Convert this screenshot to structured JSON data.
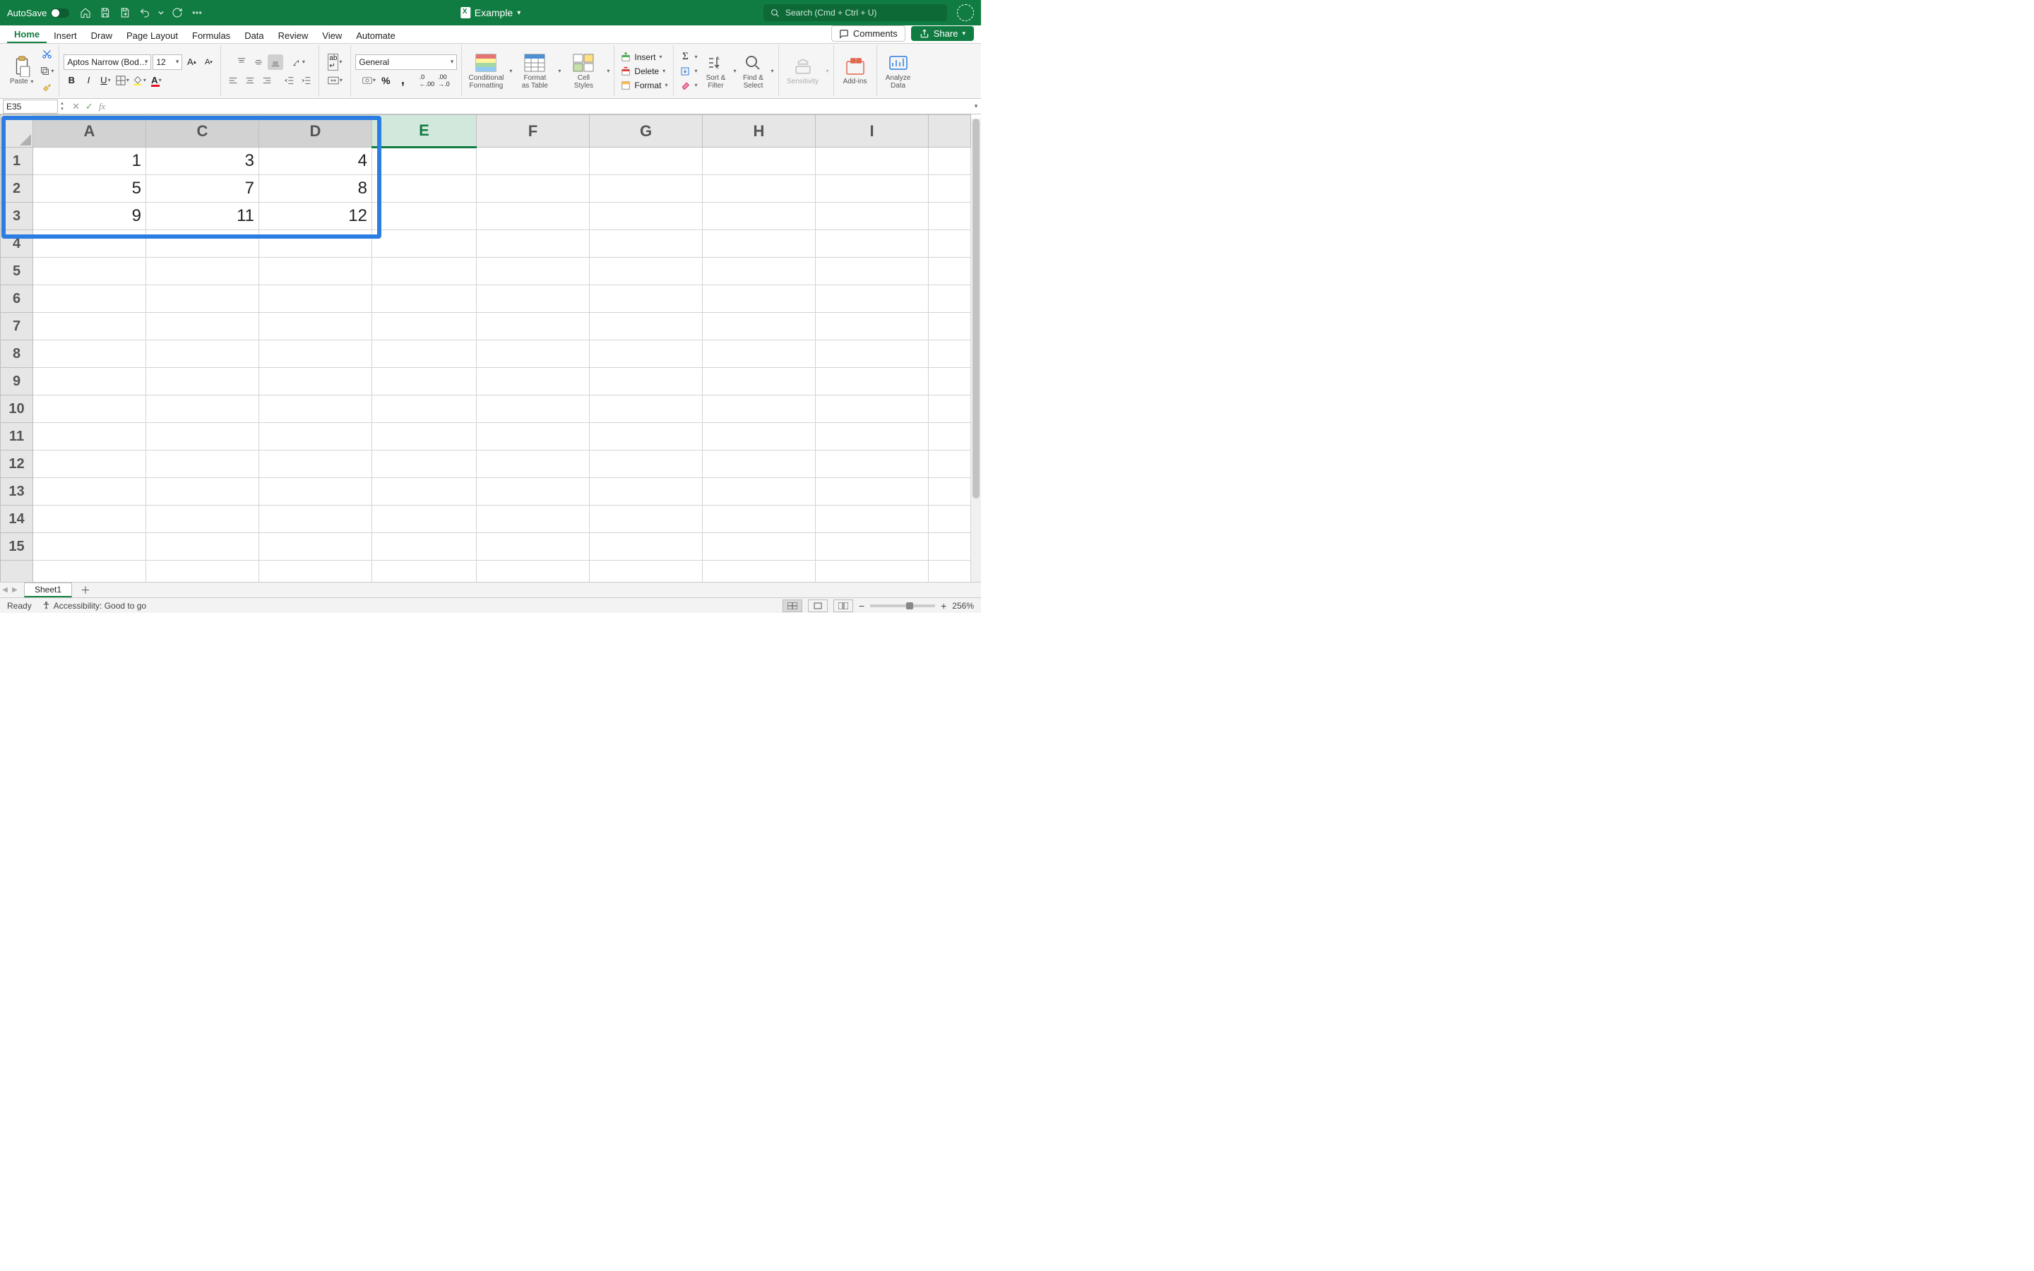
{
  "titlebar": {
    "autosave_label": "AutoSave",
    "doc_name": "Example",
    "search_placeholder": "Search (Cmd + Ctrl + U)"
  },
  "tabs": [
    "Home",
    "Insert",
    "Draw",
    "Page Layout",
    "Formulas",
    "Data",
    "Review",
    "View",
    "Automate"
  ],
  "active_tab": "Home",
  "ribbon_right": {
    "comments": "Comments",
    "share": "Share"
  },
  "ribbon": {
    "paste": "Paste",
    "font_name": "Aptos Narrow (Bod…",
    "font_size": "12",
    "number_format": "General",
    "conditional_formatting": "Conditional\nFormatting",
    "format_as_table": "Format\nas Table",
    "cell_styles": "Cell\nStyles",
    "insert": "Insert",
    "delete": "Delete",
    "format": "Format",
    "sort_filter": "Sort &\nFilter",
    "find_select": "Find &\nSelect",
    "sensitivity": "Sensitivity",
    "addins": "Add-ins",
    "analyze": "Analyze\nData"
  },
  "formula_bar": {
    "name_box": "E35",
    "formula": ""
  },
  "columns": [
    "A",
    "C",
    "D",
    "E",
    "F",
    "G",
    "H",
    "I",
    ""
  ],
  "rows": [
    "1",
    "2",
    "3",
    "4",
    "5",
    "6",
    "7",
    "8",
    "9",
    "10",
    "11",
    "12",
    "13",
    "14",
    "15"
  ],
  "cells": {
    "r1": {
      "A": "1",
      "C": "3",
      "D": "4"
    },
    "r2": {
      "A": "5",
      "C": "7",
      "D": "8"
    },
    "r3": {
      "A": "9",
      "C": "11",
      "D": "12"
    }
  },
  "sheet_tabs": {
    "active": "Sheet1"
  },
  "status": {
    "ready": "Ready",
    "accessibility": "Accessibility: Good to go",
    "zoom": "256%"
  },
  "colors": {
    "brand": "#107c41",
    "highlight": "#2b7de1"
  }
}
